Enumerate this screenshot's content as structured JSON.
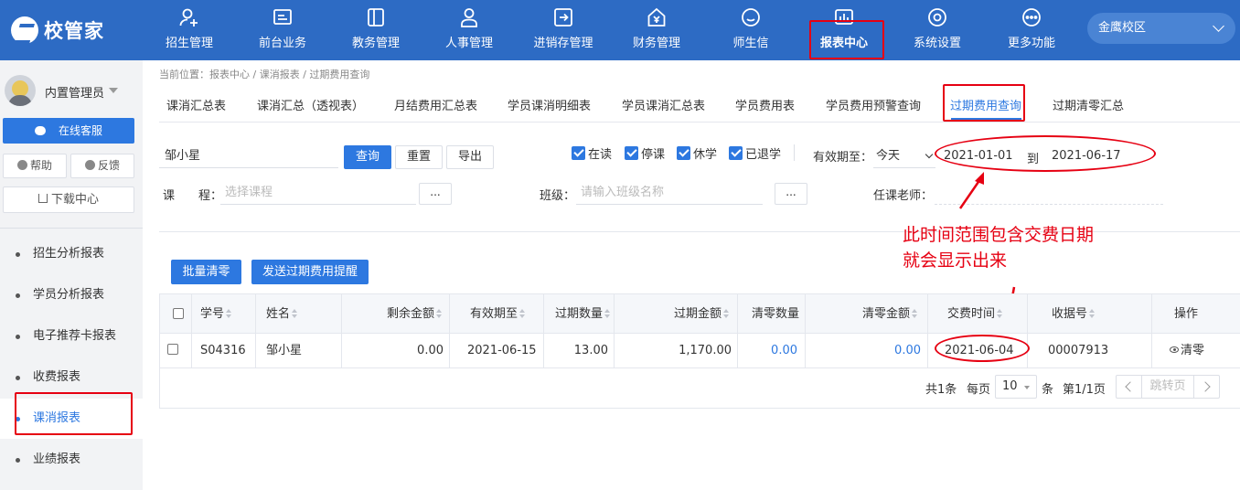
{
  "app": {
    "name": "校管家"
  },
  "nav": [
    {
      "label": "招生管理",
      "icon": "user-add-icon"
    },
    {
      "label": "前台业务",
      "icon": "reception-icon"
    },
    {
      "label": "教务管理",
      "icon": "book-icon"
    },
    {
      "label": "人事管理",
      "icon": "person-icon"
    },
    {
      "label": "进销存管理",
      "icon": "inventory-icon"
    },
    {
      "label": "财务管理",
      "icon": "finance-icon"
    },
    {
      "label": "师生信",
      "icon": "message-icon"
    },
    {
      "label": "报表中心",
      "icon": "report-icon",
      "active": true
    },
    {
      "label": "系统设置",
      "icon": "settings-icon"
    },
    {
      "label": "更多功能",
      "icon": "more-icon"
    }
  ],
  "campus": {
    "selected": "金鹰校区"
  },
  "sidebar": {
    "admin_name": "内置管理员",
    "online_service": "在线客服",
    "help": "帮助",
    "feedback": "反馈",
    "download_center": "下载中心",
    "items": [
      {
        "label": "招生分析报表"
      },
      {
        "label": "学员分析报表"
      },
      {
        "label": "电子推荐卡报表"
      },
      {
        "label": "收费报表"
      },
      {
        "label": "课消报表",
        "active": true
      },
      {
        "label": "业绩报表"
      }
    ]
  },
  "breadcrumb": "当前位置：报表中心 / 课消报表 / 过期费用查询",
  "tabs": [
    {
      "label": "课消汇总表"
    },
    {
      "label": "课消汇总（透视表）"
    },
    {
      "label": "月结费用汇总表"
    },
    {
      "label": "学员课消明细表"
    },
    {
      "label": "学员课消汇总表"
    },
    {
      "label": "学员费用表"
    },
    {
      "label": "学员费用预警查询"
    },
    {
      "label": "过期费用查询",
      "active": true
    },
    {
      "label": "过期清零汇总"
    }
  ],
  "filters": {
    "student_name": "邹小星",
    "query_btn": "查询",
    "reset_btn": "重置",
    "export_btn": "导出",
    "status_checks": [
      "在读",
      "停课",
      "休学",
      "已退学"
    ],
    "validity_label": "有效期至：",
    "validity_option": "今天",
    "date_from": "2021-01-01",
    "date_to_label": "到",
    "date_to": "2021-06-17",
    "course_label": "课　　程：",
    "course_placeholder": "选择课程",
    "dots": "...",
    "class_label": "班级：",
    "class_placeholder": "请输入班级名称",
    "teacher_label": "任课老师："
  },
  "actions": {
    "batch_clear": "批量清零",
    "send_reminder": "发送过期费用提醒"
  },
  "table": {
    "headers": [
      "学号",
      "姓名",
      "剩余金额",
      "有效期至",
      "过期数量",
      "过期金额",
      "清零数量",
      "清零金额",
      "交费时间",
      "收据号",
      "操作"
    ],
    "rows": [
      {
        "student_no": "S04316",
        "name": "邹小星",
        "remaining_amount": "0.00",
        "valid_until": "2021-06-15",
        "expired_qty": "13.00",
        "expired_amount": "1,170.00",
        "cleared_qty": "0.00",
        "cleared_amount": "0.00",
        "payment_time": "2021-06-04",
        "receipt_no": "00007913",
        "action": "清零"
      }
    ]
  },
  "pagination": {
    "total": "共1条",
    "per_page_label": "每页",
    "per_page": "10",
    "unit": "条",
    "page": "第1/1页",
    "jump": "跳转页"
  },
  "annotation": {
    "line1": "此时间范围包含交费日期",
    "line2": "就会显示出来",
    "color": "#e60012"
  },
  "colors": {
    "primary": "#2d6bc4",
    "accent": "#2d78e0"
  }
}
